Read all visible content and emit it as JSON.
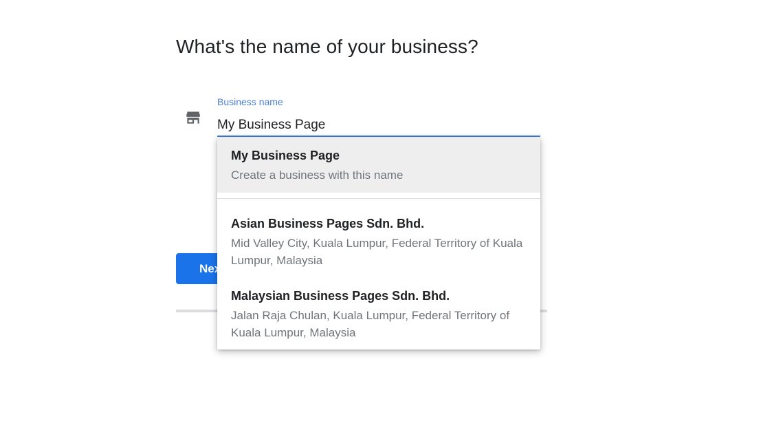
{
  "page": {
    "title": "What's the name of your business?"
  },
  "business_field": {
    "label": "Business name",
    "value": "My Business Page",
    "icon": "store-icon"
  },
  "suggestions": [
    {
      "title": "My Business Page",
      "subtitle": "Create a business with this name"
    },
    {
      "title": "Asian Business Pages Sdn. Bhd.",
      "subtitle": "Mid Valley City, Kuala Lumpur, Federal Territory of Kuala Lumpur, Malaysia"
    },
    {
      "title": "Malaysian Business Pages Sdn. Bhd.",
      "subtitle": "Jalan Raja Chulan, Kuala Lumpur, Federal Territory of Kuala Lumpur, Malaysia"
    }
  ],
  "actions": {
    "next_label": "Next"
  },
  "colors": {
    "accent": "#1a73e8",
    "label": "#4b7fd6",
    "highlight": "#eeeeee"
  }
}
